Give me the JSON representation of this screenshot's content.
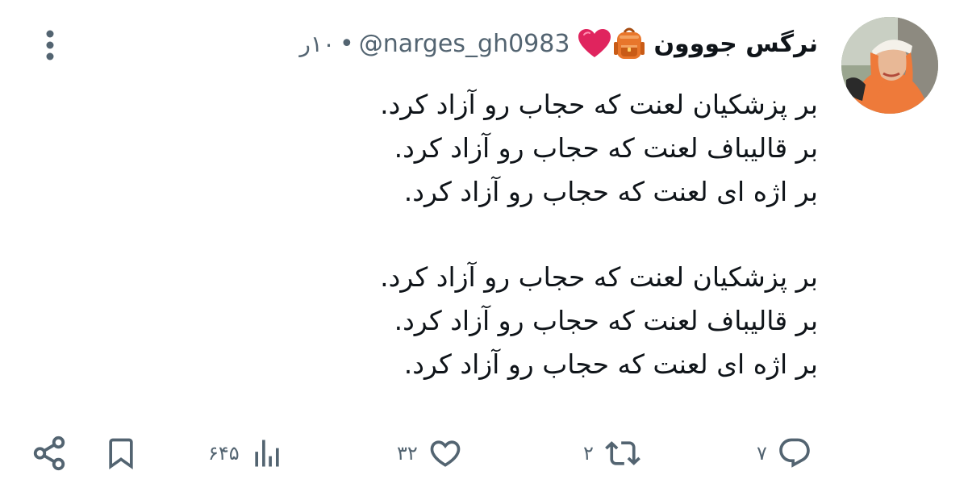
{
  "user": {
    "display_name": "نرگس جووون",
    "handle": "@narges_gh0983",
    "time": "۱۰ر",
    "separator": "•"
  },
  "icons": {
    "avatar": "avatar-photo",
    "heart": "red-heart-emoji",
    "backpack": "backpack-emoji",
    "more": "more-vertical-icon",
    "reply": "reply-icon",
    "retweet": "retweet-icon",
    "like": "heart-icon",
    "views": "views-chart-icon",
    "bookmark": "bookmark-icon",
    "share": "share-icon"
  },
  "tweet": {
    "lines": [
      "بر پزشکیان لعنت که حجاب رو آزاد کرد.",
      "بر قالیباف لعنت که حجاب رو آزاد کرد.",
      "بر اژه ای لعنت که حجاب رو آزاد کرد.",
      "",
      "بر پزشکیان لعنت که حجاب رو آزاد کرد.",
      "بر قالیباف لعنت که حجاب رو آزاد کرد.",
      "بر اژه ای لعنت که حجاب رو آزاد کرد."
    ]
  },
  "stats": {
    "replies": "۷",
    "retweets": "۲",
    "likes": "۳۲",
    "views": "۶۴۵"
  },
  "colors": {
    "text": "#0f1419",
    "secondary": "#536471",
    "icon": "#536471",
    "heart_red": "#e0245e",
    "bag_orange": "#e8762b"
  }
}
